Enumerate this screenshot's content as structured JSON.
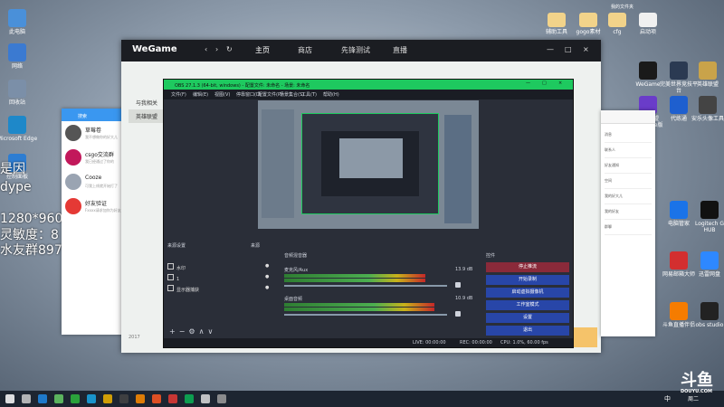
{
  "desktop_left": [
    {
      "label": "此电脑",
      "color": "#4a90d9"
    },
    {
      "label": "网络",
      "color": "#3b7ad1"
    },
    {
      "label": "回收站",
      "color": "#7b8fa8"
    },
    {
      "label": "Microsoft Edge",
      "color": "#1e88c9"
    },
    {
      "label": "控制面板",
      "color": "#2d7dd2"
    }
  ],
  "desktop_top_right": [
    {
      "label": "辅助工具",
      "color": "#f2d38a"
    },
    {
      "label": "gogo素材",
      "color": "#f2d38a"
    },
    {
      "label": "cfg",
      "color": "#f2d38a"
    },
    {
      "label": "启动项",
      "color": "#f0f0f0"
    },
    {
      "label": "我的文件夹",
      "color": "#f2d38a"
    }
  ],
  "desktop_right": [
    {
      "label": "WeGame",
      "color": "#1a1a1a"
    },
    {
      "label": "完美世界竞技平台",
      "color": "#2b3a52"
    },
    {
      "label": "英雄联盟",
      "color": "#c9a34a"
    },
    {
      "label": "代练通",
      "color": "#1e5fcf"
    },
    {
      "label": "英雄联盟WeGame版",
      "color": "#6a3cc9"
    },
    {
      "label": "安乐头像工具",
      "color": "#444"
    },
    {
      "label": "电脑管家",
      "color": "#1a73e8"
    },
    {
      "label": "Logitech G HUB",
      "color": "#111"
    },
    {
      "label": "网易邮箱大师",
      "color": "#d32f2f"
    },
    {
      "label": "迅雷网盘",
      "color": "#2e88ff"
    },
    {
      "label": "斗鱼直播伴侣",
      "color": "#f57c00"
    },
    {
      "label": "obs studio",
      "color": "#222"
    }
  ],
  "overlay_text": [
    "是因",
    "dype",
    "1280*960",
    "灵敏度：8",
    "水友群897"
  ],
  "wegame": {
    "logo": "WeGame",
    "tabs": [
      "主页",
      "商店",
      "先锋测试",
      "直播"
    ],
    "left_items": [
      "与我相关",
      "英雄联盟"
    ],
    "bottom_text": "2017"
  },
  "chat": {
    "search_placeholder": "搜索",
    "rows": [
      {
        "name": "草莓卷",
        "msg": "我不想做你的好大儿",
        "color": "#555"
      },
      {
        "name": "csgo交流群",
        "msg": "我已经通过了你的",
        "color": "#c2185b"
      },
      {
        "name": "Cooze",
        "msg": "可我上线就开始打了",
        "color": "#9aa4b2"
      },
      {
        "name": "好友验证",
        "msg": "Fxxxx请求加你为好友",
        "color": "#e53935"
      }
    ]
  },
  "obs": {
    "title": "OBS 27.1.3 (64-bit, windows) - 配置文件: 未命名 - 场景: 未命名",
    "menu": [
      "文件(F)",
      "编辑(E)",
      "视图(V)",
      "停靠窗口(D)",
      "配置文件(P)",
      "场景集合(S)",
      "工具(T)",
      "帮助(H)"
    ],
    "panels": {
      "scenes": "来源设置",
      "sources": "来源",
      "mixer": "音频混音器",
      "controls": "控件"
    },
    "sources": [
      {
        "icon": "image-icon",
        "label": "水印"
      },
      {
        "icon": "text-icon",
        "label": "1"
      },
      {
        "icon": "monitor-icon",
        "label": "显示器捕获"
      }
    ],
    "mixer": [
      {
        "label": "麦克风/Aux",
        "db": "13.9 dB",
        "level": 0.75
      },
      {
        "label": "桌面音频",
        "db": "10.9 dB",
        "level": 0.8
      }
    ],
    "controls": [
      "停止推流",
      "开始录制",
      "启动虚拟摄像机",
      "工作室模式",
      "设置",
      "退出"
    ],
    "status": {
      "live": "LIVE: 00:00:00",
      "rec": "REC: 00:00:00",
      "cpu": "CPU: 1.0%, 60.00 fps"
    }
  },
  "qq": {
    "lines": [
      "消息",
      "联系人",
      "好友通知",
      "空间",
      "我的好大儿",
      "我的好友",
      "群聊"
    ]
  },
  "taskbar": {
    "icons": [
      "start-icon",
      "search-icon",
      "steam-icon",
      "app-icon",
      "wechat-icon",
      "qq-icon",
      "yy-icon",
      "terminal-icon",
      "wegame-icon",
      "taobao-icon",
      "chrome-icon",
      "obs-icon",
      "cursor-icon",
      "file-icon"
    ],
    "ime": "中",
    "clock": "周二"
  },
  "watermark": {
    "main": "斗鱼",
    "sub": "DOUYU.COM"
  }
}
